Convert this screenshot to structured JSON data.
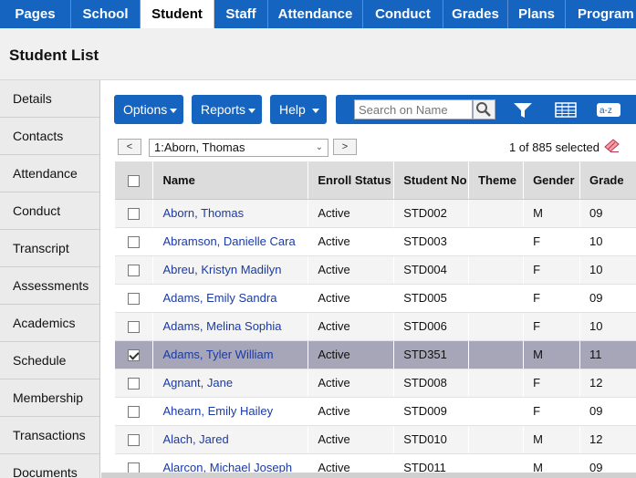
{
  "topnav": {
    "tabs": [
      {
        "label": "Pages",
        "active": false
      },
      {
        "label": "School",
        "active": false
      },
      {
        "label": "Student",
        "active": true
      },
      {
        "label": "Staff",
        "active": false
      },
      {
        "label": "Attendance",
        "active": false
      },
      {
        "label": "Conduct",
        "active": false
      },
      {
        "label": "Grades",
        "active": false
      },
      {
        "label": "Plans",
        "active": false
      },
      {
        "label": "Program",
        "active": false
      }
    ]
  },
  "page": {
    "title": "Student List"
  },
  "sidenav": {
    "items": [
      "Details",
      "Contacts",
      "Attendance",
      "Conduct",
      "Transcript",
      "Assessments",
      "Academics",
      "Schedule",
      "Membership",
      "Transactions",
      "Documents"
    ]
  },
  "toolbar": {
    "options_label": "Options",
    "reports_label": "Reports",
    "help_label": "Help",
    "search_placeholder": "Search on Name"
  },
  "record_nav": {
    "prev_label": "<",
    "next_label": ">",
    "current": "1:Aborn, Thomas",
    "selected_text": "1 of 885 selected"
  },
  "table": {
    "columns": [
      "Name",
      "Enroll Status",
      "Student No",
      "Theme",
      "Gender",
      "Grade"
    ],
    "rows": [
      {
        "name": "Aborn, Thomas",
        "status": "Active",
        "student_no": "STD002",
        "theme": "",
        "gender": "M",
        "grade": "09",
        "checked": false
      },
      {
        "name": "Abramson, Danielle Cara",
        "status": "Active",
        "student_no": "STD003",
        "theme": "",
        "gender": "F",
        "grade": "10",
        "checked": false
      },
      {
        "name": "Abreu, Kristyn Madilyn",
        "status": "Active",
        "student_no": "STD004",
        "theme": "",
        "gender": "F",
        "grade": "10",
        "checked": false
      },
      {
        "name": "Adams, Emily Sandra",
        "status": "Active",
        "student_no": "STD005",
        "theme": "",
        "gender": "F",
        "grade": "09",
        "checked": false
      },
      {
        "name": "Adams, Melina Sophia",
        "status": "Active",
        "student_no": "STD006",
        "theme": "",
        "gender": "F",
        "grade": "10",
        "checked": false
      },
      {
        "name": "Adams, Tyler William",
        "status": "Active",
        "student_no": "STD351",
        "theme": "",
        "gender": "M",
        "grade": "11",
        "checked": true
      },
      {
        "name": "Agnant, Jane",
        "status": "Active",
        "student_no": "STD008",
        "theme": "",
        "gender": "F",
        "grade": "12",
        "checked": false
      },
      {
        "name": "Ahearn, Emily Hailey",
        "status": "Active",
        "student_no": "STD009",
        "theme": "",
        "gender": "F",
        "grade": "09",
        "checked": false
      },
      {
        "name": "Alach, Jared",
        "status": "Active",
        "student_no": "STD010",
        "theme": "",
        "gender": "M",
        "grade": "12",
        "checked": false
      },
      {
        "name": "Alarcon, Michael Joseph",
        "status": "Active",
        "student_no": "STD011",
        "theme": "",
        "gender": "M",
        "grade": "09",
        "checked": false
      }
    ]
  },
  "colors": {
    "brand": "#1565c0",
    "link": "#1a3aa6",
    "selected_row": "#a6a6b8"
  }
}
